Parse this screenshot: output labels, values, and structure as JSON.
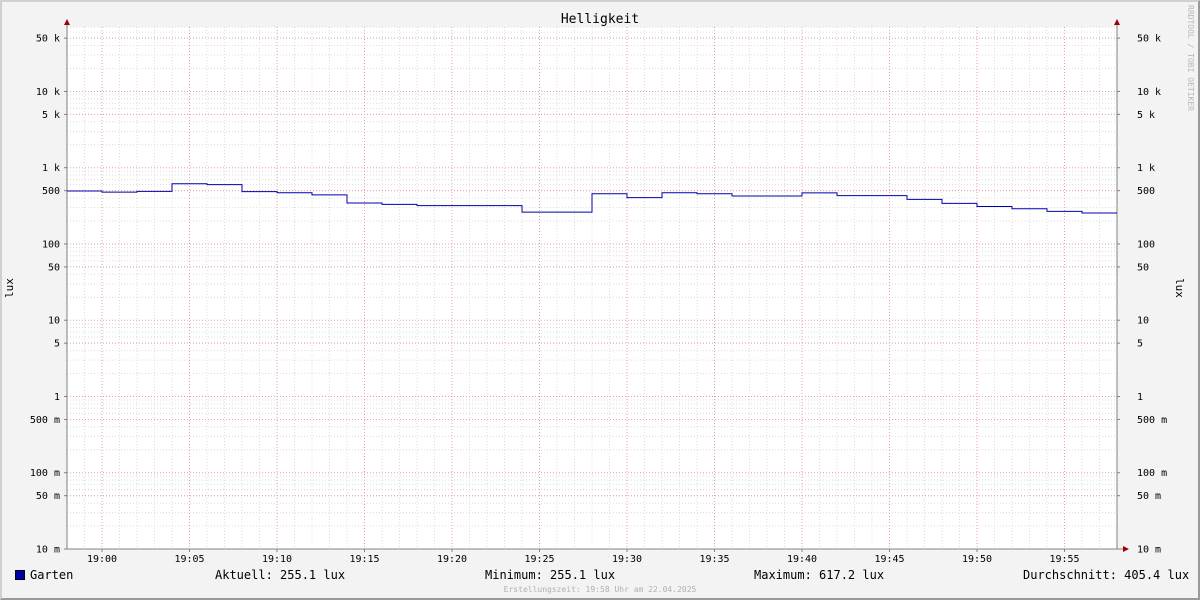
{
  "chart_data": {
    "type": "line",
    "title": "Helligkeit",
    "ylabel": "lux",
    "y_scale": "log",
    "ylim": [
      0.01,
      70000
    ],
    "x_range": [
      "18:58",
      "19:58"
    ],
    "x_ticks": [
      "19:00",
      "19:05",
      "19:10",
      "19:15",
      "19:20",
      "19:25",
      "19:30",
      "19:35",
      "19:40",
      "19:45",
      "19:50",
      "19:55"
    ],
    "y_ticks": [
      {
        "value": 50000,
        "label": "50 k"
      },
      {
        "value": 10000,
        "label": "10 k"
      },
      {
        "value": 5000,
        "label": "5 k"
      },
      {
        "value": 1000,
        "label": "1 k"
      },
      {
        "value": 500,
        "label": "500"
      },
      {
        "value": 100,
        "label": "100"
      },
      {
        "value": 50,
        "label": "50"
      },
      {
        "value": 10,
        "label": "10"
      },
      {
        "value": 5,
        "label": "5"
      },
      {
        "value": 1,
        "label": "1"
      },
      {
        "value": 0.5,
        "label": "500 m"
      },
      {
        "value": 0.1,
        "label": "100 m"
      },
      {
        "value": 0.05,
        "label": "50 m"
      },
      {
        "value": 0.01,
        "label": "10 m"
      }
    ],
    "grid": true,
    "series": [
      {
        "name": "Garten",
        "color": "#0000a8",
        "step": "post",
        "x": [
          "18:58",
          "19:00",
          "19:02",
          "19:04",
          "19:06",
          "19:08",
          "19:10",
          "19:12",
          "19:14",
          "19:16",
          "19:18",
          "19:20",
          "19:22",
          "19:24",
          "19:26",
          "19:28",
          "19:30",
          "19:32",
          "19:34",
          "19:36",
          "19:38",
          "19:40",
          "19:42",
          "19:44",
          "19:46",
          "19:48",
          "19:50",
          "19:52",
          "19:54",
          "19:56",
          "19:58"
        ],
        "values": [
          495,
          478,
          490,
          617,
          600,
          485,
          470,
          440,
          345,
          330,
          318,
          318,
          318,
          262,
          262,
          455,
          405,
          470,
          455,
          425,
          425,
          468,
          430,
          430,
          385,
          340,
          310,
          290,
          268,
          255,
          255
        ]
      }
    ]
  },
  "legend": {
    "series_name": "Garten",
    "current": "Aktuell: 255.1 lux",
    "minimum": "Minimum: 255.1 lux",
    "maximum": "Maximum: 617.2 lux",
    "average": "Durchschnitt: 405.4 lux"
  },
  "footer": "Erstellungszeit: 19:58 Uhr am 22.04.2025",
  "watermark": "RRDTOOL / TOBI OETIKER"
}
